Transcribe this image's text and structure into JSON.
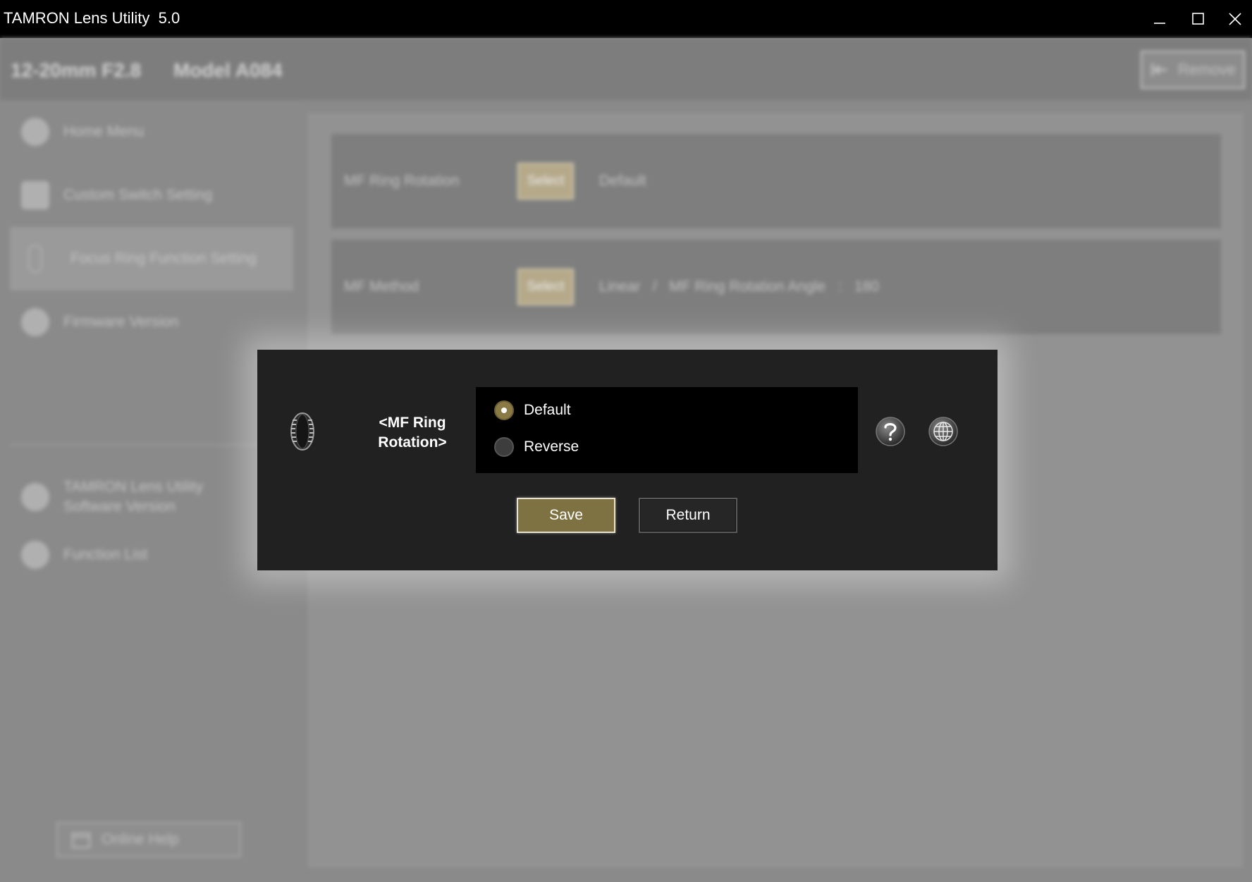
{
  "window": {
    "title": "TAMRON Lens Utility  5.0",
    "controls": [
      "minimize-icon",
      "maximize-icon",
      "close-icon"
    ]
  },
  "header": {
    "lens_name": "12-20mm F2.8",
    "model": "Model A084",
    "remove_label": "Remove"
  },
  "sidebar": {
    "items": [
      {
        "label": "Home Menu",
        "icon": "home-icon"
      },
      {
        "label": "Custom Switch Setting",
        "icon": "switch-icon"
      },
      {
        "label": "Focus Ring Function Setting",
        "icon": "focus-ring-icon",
        "active": true
      },
      {
        "label": "Firmware Version",
        "icon": "firmware-icon"
      },
      {
        "label": "TAMRON Lens Utility Software Version",
        "icon": "info-icon"
      },
      {
        "label": "Function List",
        "icon": "list-icon"
      }
    ],
    "online_help_label": "Online Help"
  },
  "settings": [
    {
      "label": "MF Ring Rotation",
      "select_label": "Select",
      "value": "Default"
    },
    {
      "label": "MF Method",
      "select_label": "Select",
      "value": "Linear   /   MF Ring Rotation Angle   :   180"
    }
  ],
  "dialog": {
    "title_line1": "<MF Ring",
    "title_line2": "Rotation>",
    "options": [
      {
        "label": "Default",
        "selected": true
      },
      {
        "label": "Reverse",
        "selected": false
      }
    ],
    "save_label": "Save",
    "return_label": "Return"
  },
  "colors": {
    "accent": "#7e7142",
    "dialog_bg": "#212121",
    "titlebar_bg": "#000000"
  }
}
